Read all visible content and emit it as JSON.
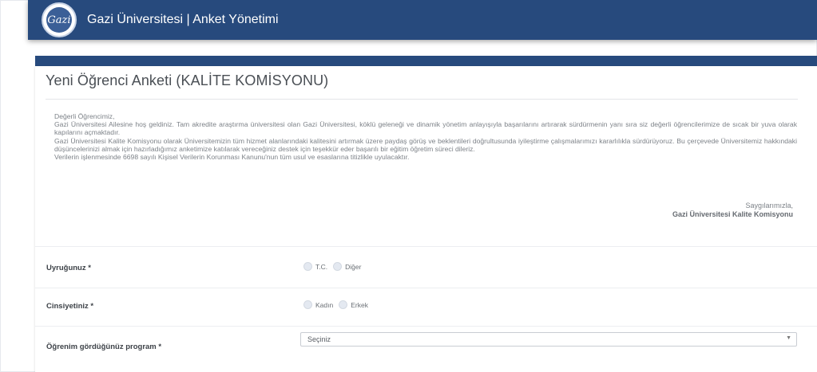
{
  "header": {
    "brand": "Gazi Üniversitesi | Anket Yönetimi",
    "logo_text": "Gazi"
  },
  "page": {
    "title": "Yeni Öğrenci Anketi (KALİTE KOMİSYONU)"
  },
  "intro": {
    "lines": [
      "Değerli Öğrencimiz,",
      "Gazi Üniversitesi Ailesine hoş geldiniz. Tam akredite araştırma üniversitesi olan Gazi Üniversitesi, köklü geleneği ve dinamik yönetim anlayışıyla başarılarını artırarak sürdürmenin yanı sıra siz değerli öğrencilerimize de sıcak bir yuva olarak kapılarını açmaktadır.",
      "Gazi Üniversitesi Kalite Komisyonu olarak Üniversitemizin tüm hizmet alanlarındaki kalitesini artırmak üzere paydaş görüş ve beklentileri doğrultusunda iyileştirme çalışmalarımızı kararlılıkla sürdürüyoruz. Bu çerçevede Üniversitemiz hakkındaki düşüncelerinizi almak için hazırladığımız anketimize katılarak vereceğiniz destek için teşekkür eder başarılı bir eğitim öğretim süreci dileriz.",
      "Verilerin işlenmesinde 6698 sayılı Kişisel Verilerin Korunması Kanunu'nun tüm usul ve esaslarına titizlikle uyulacaktır."
    ],
    "closing": "Saygılarımızla,",
    "signature": "Gazi Üniversitesi Kalite Komisyonu"
  },
  "form": {
    "nationality": {
      "label": "Uyruğunuz *",
      "options": [
        "T.C.",
        "Diğer"
      ]
    },
    "gender": {
      "label": "Cinsiyetiniz *",
      "options": [
        "Kadın",
        "Erkek"
      ]
    },
    "program": {
      "label": "Öğrenim gördüğünüz program *",
      "selected": "Seçiniz"
    }
  },
  "colors": {
    "navbar": "#274a7d",
    "accent_strip": "#274a7d"
  }
}
